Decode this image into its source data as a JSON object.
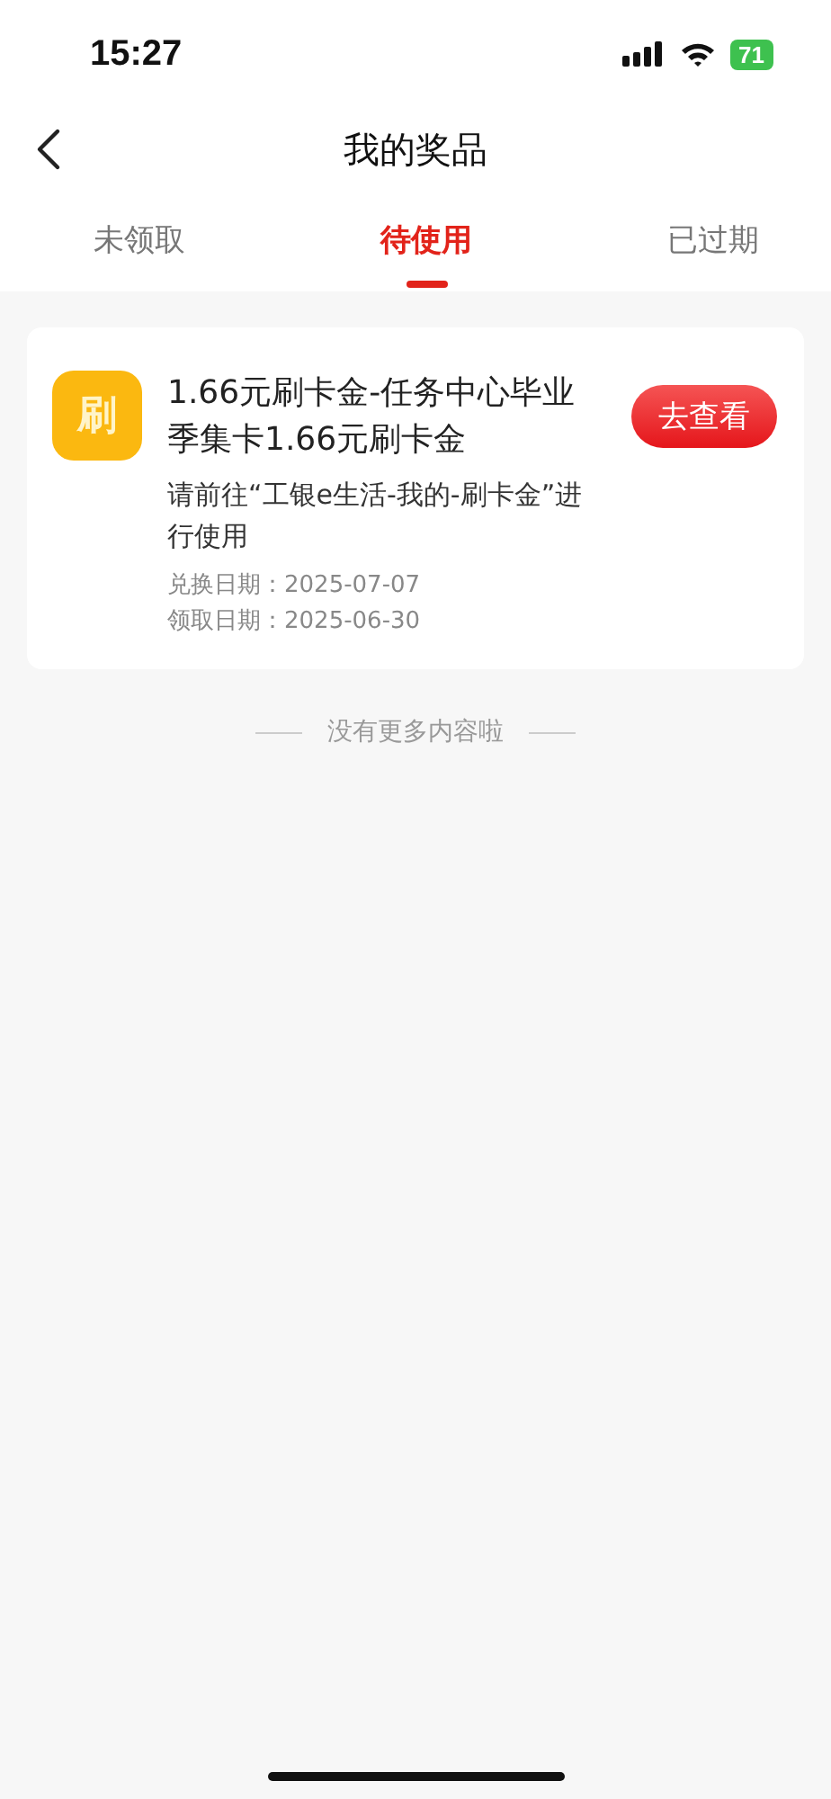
{
  "status_bar": {
    "time": "15:27",
    "battery": "71"
  },
  "nav": {
    "title": "我的奖品"
  },
  "tabs": [
    {
      "label": "未领取",
      "selected": false
    },
    {
      "label": "待使用",
      "selected": true
    },
    {
      "label": "已过期",
      "selected": false
    }
  ],
  "prizes": [
    {
      "icon_text": "刷",
      "title": "1.66元刷卡金-任务中心毕业季集卡1.66元刷卡金",
      "description": "请前往“工银e生活-我的-刷卡金”进行使用",
      "dates": [
        "兑换日期：2025-07-07",
        "领取日期：2025-06-30"
      ],
      "action": "去查看"
    }
  ],
  "end_note": "没有更多内容啦"
}
